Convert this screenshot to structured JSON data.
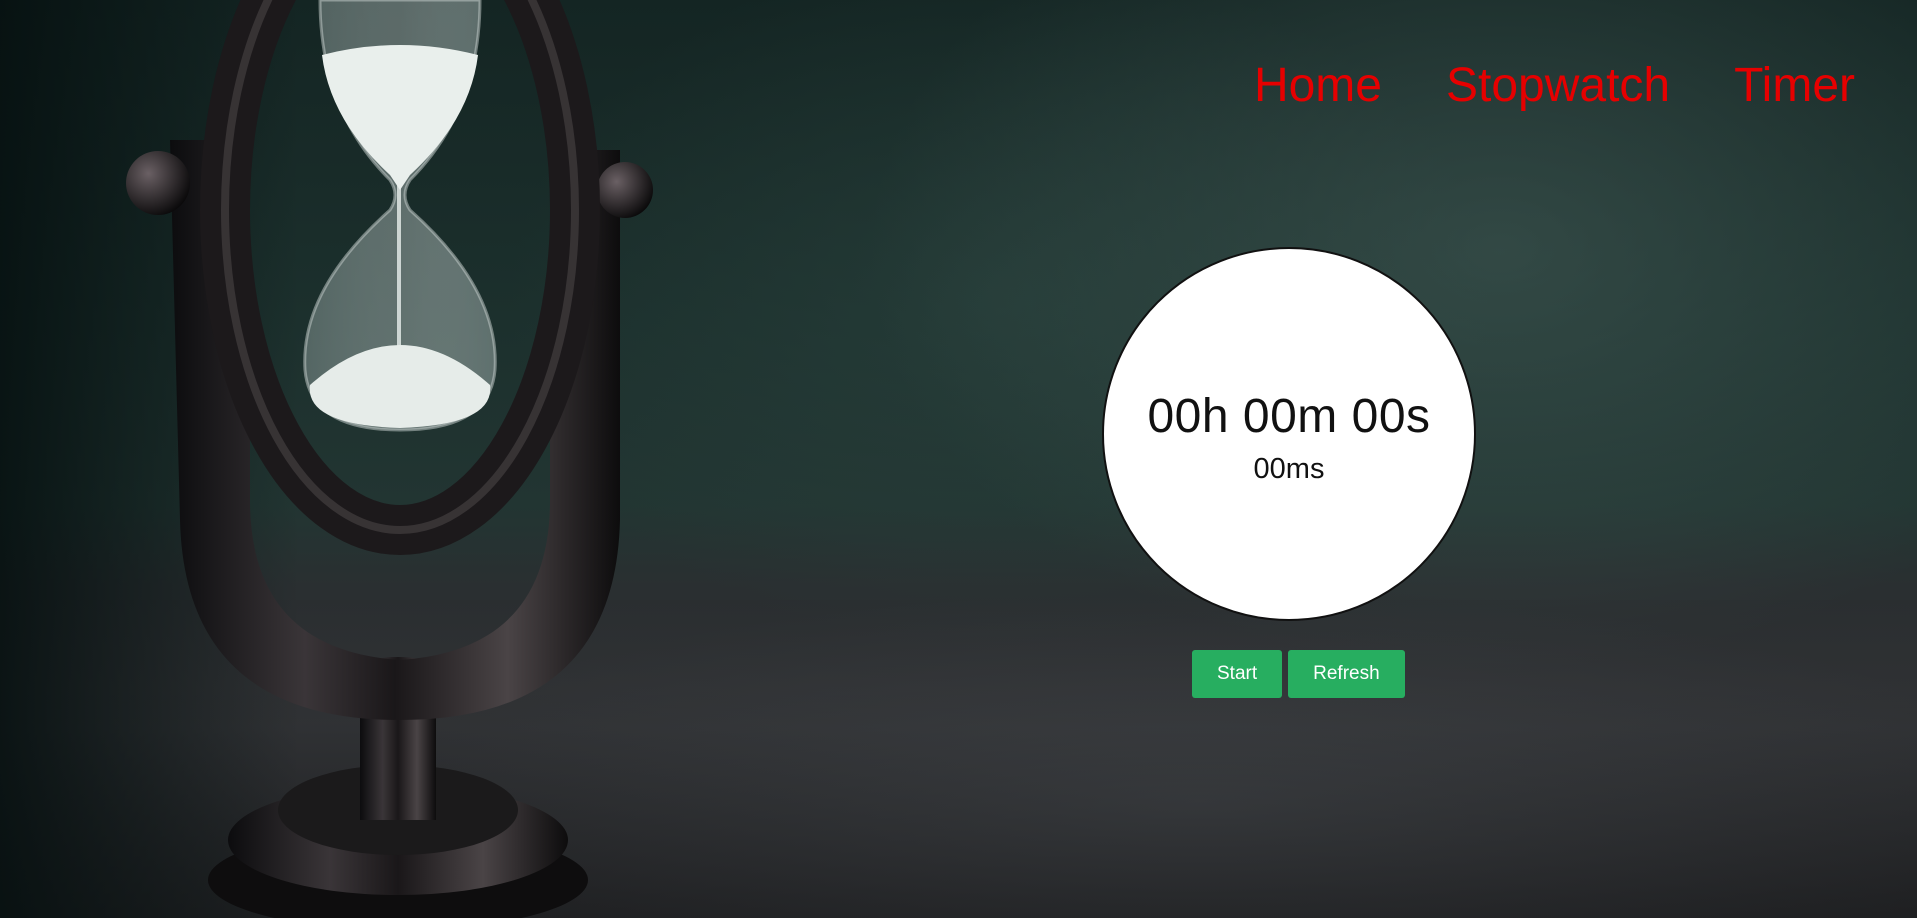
{
  "nav": {
    "home": "Home",
    "stopwatch": "Stopwatch",
    "timer": "Timer",
    "link_color": "#e60000"
  },
  "stopwatch": {
    "time": "00h 00m 00s",
    "milliseconds": "00ms"
  },
  "controls": {
    "start_label": "Start",
    "refresh_label": "Refresh",
    "button_color": "#27ae60"
  },
  "background": {
    "icon": "hourglass-icon"
  }
}
